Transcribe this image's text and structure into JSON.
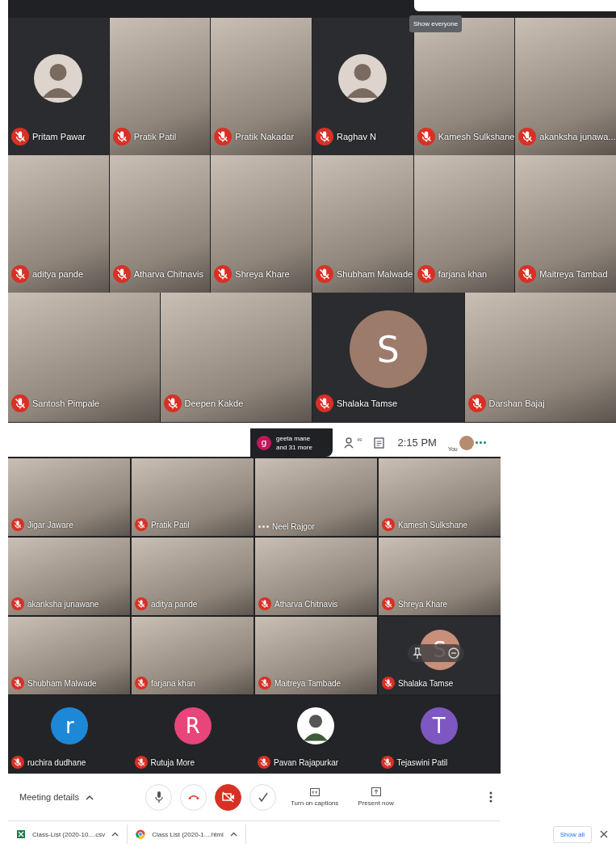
{
  "top_view": {
    "tooltip": "Show everyone",
    "rows": [
      {
        "tiles": [
          {
            "name": "Pritam Pawar",
            "kind": "photo-avatar",
            "muted": true
          },
          {
            "name": "Pratik Patil",
            "kind": "video",
            "muted": true
          },
          {
            "name": "Pratik Nakadar",
            "kind": "video",
            "muted": true
          },
          {
            "name": "Raghav N",
            "kind": "photo-avatar",
            "muted": true
          },
          {
            "name": "Kamesh Sulkshane",
            "kind": "video",
            "muted": true
          },
          {
            "name": "akanksha junawa...",
            "kind": "video",
            "muted": true
          }
        ]
      },
      {
        "tiles": [
          {
            "name": "aditya pande",
            "kind": "video",
            "muted": true
          },
          {
            "name": "Atharva Chitnavis",
            "kind": "video",
            "muted": true
          },
          {
            "name": "Shreya Khare",
            "kind": "video",
            "muted": true
          },
          {
            "name": "Shubham Malwade",
            "kind": "video",
            "muted": true
          },
          {
            "name": "farjana khan",
            "kind": "video",
            "muted": true
          },
          {
            "name": "Maitreya Tambad",
            "kind": "video",
            "muted": true
          }
        ]
      },
      {
        "tiles": [
          {
            "name": "Santosh Pimpale",
            "kind": "video",
            "muted": true
          },
          {
            "name": "Deepen Kakde",
            "kind": "video",
            "muted": true
          },
          {
            "name": "Shalaka Tamse",
            "kind": "letter",
            "letter": "S",
            "color": "#9c7b6b",
            "muted": true
          },
          {
            "name": "Darshan Bajaj",
            "kind": "video",
            "muted": true
          }
        ]
      }
    ]
  },
  "bottom_view": {
    "header": {
      "presenter": {
        "letter": "g",
        "color": "#c2185b",
        "line_1": "geeta mane",
        "line_2": "and 31 more"
      },
      "people_count": "49",
      "time": "2:15 PM",
      "self_label": "You"
    },
    "tiles": [
      {
        "name": "Jigar Jaware",
        "kind": "video",
        "muted": true,
        "hovered": false
      },
      {
        "name": "Pratik Patil",
        "kind": "video",
        "muted": true,
        "hovered": false
      },
      {
        "name": "Neel Rajgor",
        "kind": "video",
        "muted": false,
        "hovered": false
      },
      {
        "name": "Kamesh Sulkshane",
        "kind": "video",
        "muted": true,
        "hovered": false
      },
      {
        "name": "akanksha junawane",
        "kind": "video",
        "muted": true,
        "hovered": false
      },
      {
        "name": "aditya pande",
        "kind": "video",
        "muted": true,
        "hovered": false
      },
      {
        "name": "Atharva Chitnavis",
        "kind": "video",
        "muted": true,
        "hovered": false
      },
      {
        "name": "Shreya Khare",
        "kind": "video",
        "muted": true,
        "hovered": false
      },
      {
        "name": "Shubham Malwade",
        "kind": "video",
        "muted": true,
        "hovered": false
      },
      {
        "name": "farjana khan",
        "kind": "video",
        "muted": true,
        "hovered": false
      },
      {
        "name": "Maitreya Tambade",
        "kind": "video",
        "muted": true,
        "hovered": false
      },
      {
        "name": "Shalaka Tamse",
        "kind": "letter",
        "letter": "S",
        "color": "#c98f7a",
        "muted": true,
        "hovered": true
      },
      {
        "name": "ruchira dudhane",
        "kind": "letter",
        "letter": "r",
        "color": "#1e88d8",
        "muted": true,
        "hovered": false
      },
      {
        "name": "Rutuja More",
        "kind": "letter",
        "letter": "R",
        "color": "#e8457a",
        "muted": true,
        "hovered": false
      },
      {
        "name": "Pavan Rajapurkar",
        "kind": "photo-avatar",
        "muted": true,
        "hovered": false
      },
      {
        "name": "Tejaswini Patil",
        "kind": "letter",
        "letter": "T",
        "color": "#7e57c2",
        "muted": true,
        "hovered": false
      }
    ],
    "controls": {
      "meeting_details": "Meeting details",
      "camera_on": false,
      "captions": "Turn on captions",
      "present": "Present now"
    },
    "downloads": {
      "files": [
        {
          "name": "Class-List (2020-10....csv",
          "kind": "sheet"
        },
        {
          "name": "Class List (2020-1....html",
          "kind": "browser"
        }
      ],
      "show_all": "Show all"
    }
  }
}
